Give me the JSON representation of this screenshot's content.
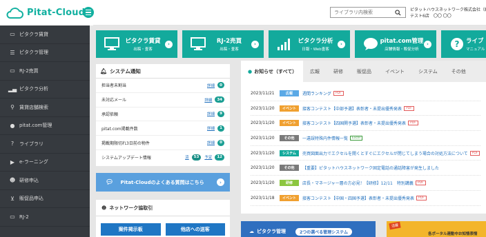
{
  "header": {
    "brand": "Pitat-Cloud",
    "search_placeholder": "ライブラリ内検索",
    "user_line1": "ピタットハウスネットワーク株式会社（練習",
    "user_line2": "テスト6店　〇〇 〇〇"
  },
  "sidebar": {
    "items": [
      {
        "label": "ピタクラ賃貸",
        "icon": "monitor-icon"
      },
      {
        "label": "ピタクラ管理",
        "icon": "list-icon"
      },
      {
        "label": "RJ-2売買",
        "icon": "monitor-icon"
      },
      {
        "label": "ピタクラ分析",
        "icon": "bar-chart-icon"
      },
      {
        "label": "賃貸店舗検索",
        "icon": "search-icon"
      },
      {
        "label": "pitat.com管理",
        "icon": "chat-icon"
      },
      {
        "label": "ライブラリ",
        "icon": "question-icon"
      },
      {
        "label": "e-ラーニング",
        "icon": "video-icon"
      },
      {
        "label": "研修申込",
        "icon": "people-icon"
      },
      {
        "label": "販促品申込",
        "icon": "cart-icon"
      },
      {
        "label": "RJ-2",
        "icon": "monitor-icon"
      }
    ]
  },
  "tiles": [
    {
      "title": "ピタクラ賃貸",
      "sub": "出稿・査客",
      "icon": "monitor-icon"
    },
    {
      "title": "RJ-2売買",
      "sub": "出稿・査客",
      "icon": "monitor-icon"
    },
    {
      "title": "ピタクラ分析",
      "sub": "日報・Web査客",
      "icon": "bar-chart-icon"
    },
    {
      "title": "pitat.com管理",
      "sub": "店舗情報・販促分析",
      "icon": "chat-icon"
    },
    {
      "title": "ライブ",
      "sub": "マニュアル",
      "icon": "question-icon"
    }
  ],
  "notice": {
    "title": "システム通知",
    "rows": [
      {
        "label": "担当者未割当",
        "link": "詳細",
        "count": "0"
      },
      {
        "label": "未対応メール",
        "link": "詳細",
        "count": "34"
      },
      {
        "label": "承認依頼",
        "link": "詳細",
        "count": "9"
      },
      {
        "label": "pitat.com掲載件数",
        "link": "詳細",
        "count": "1"
      },
      {
        "label": "掲載期限切れ3日前の物件",
        "link": "詳細",
        "count": "0"
      },
      {
        "label": "システムアップデート情報",
        "link": "済",
        "count": "53",
        "link2": "予定",
        "count2": "12"
      }
    ]
  },
  "faq": {
    "label": "Pitat-Cloudのよくある質問はこちら"
  },
  "network": {
    "title": "ネットワーク協取引",
    "buttons": [
      "案件掲示板",
      "他店への送客"
    ]
  },
  "news": {
    "tabs": [
      "お知らせ（すべて）",
      "広報",
      "研修",
      "販促品",
      "イベント",
      "システム",
      "その他"
    ],
    "items": [
      {
        "date": "2023/11/21",
        "cat": "広報",
        "color": "#5aa9e6",
        "title": "週間ランキング",
        "tag": "PDF"
      },
      {
        "date": "2023/11/20",
        "cat": "イベント",
        "color": "#f0a030",
        "title": "接客コンテスト【中部予選】表彰者・未提出優秀発表",
        "tag": "PDF"
      },
      {
        "date": "2023/11/20",
        "cat": "イベント",
        "color": "#f0a030",
        "title": "接客コンテスト【四国関予選】表彰者・未提出優秀発表",
        "tag": "PDF"
      },
      {
        "date": "2023/11/20",
        "cat": "その他",
        "color": "#7a7a7a",
        "title": "一違誤特殊内件情報一覧",
        "tag": "Excel"
      },
      {
        "date": "2023/11/20",
        "cat": "システム",
        "color": "#13aa9c",
        "title": "売買図面出力でエクセルを開くとすぐにエクセルが閉じてしまう場合の対処方法について",
        "tag": "PDF"
      },
      {
        "date": "2023/11/20",
        "cat": "その他",
        "color": "#7a7a7a",
        "title": "【重要】ピタットハウスネットワーク固定電話の通話障害が発生しました",
        "tag": ""
      },
      {
        "date": "2023/11/20",
        "cat": "研修",
        "color": "#8cc63f",
        "title": "店長・マネージャー層の方必見！【研修】12/11　特別講義",
        "tag": "PDF"
      },
      {
        "date": "2023/11/18",
        "cat": "イベント",
        "color": "#f0a030",
        "title": "接客コンテスト【中国・四国予選】表彰者・未提出優秀発表",
        "tag": "PDF"
      }
    ]
  },
  "banners": {
    "banner1_title": "ピタクラ管理",
    "banner1_chip": "2つの選べる管理システム",
    "banner2_text": "各ポータル連動中お知情表情",
    "banner2_label": "活躍"
  }
}
